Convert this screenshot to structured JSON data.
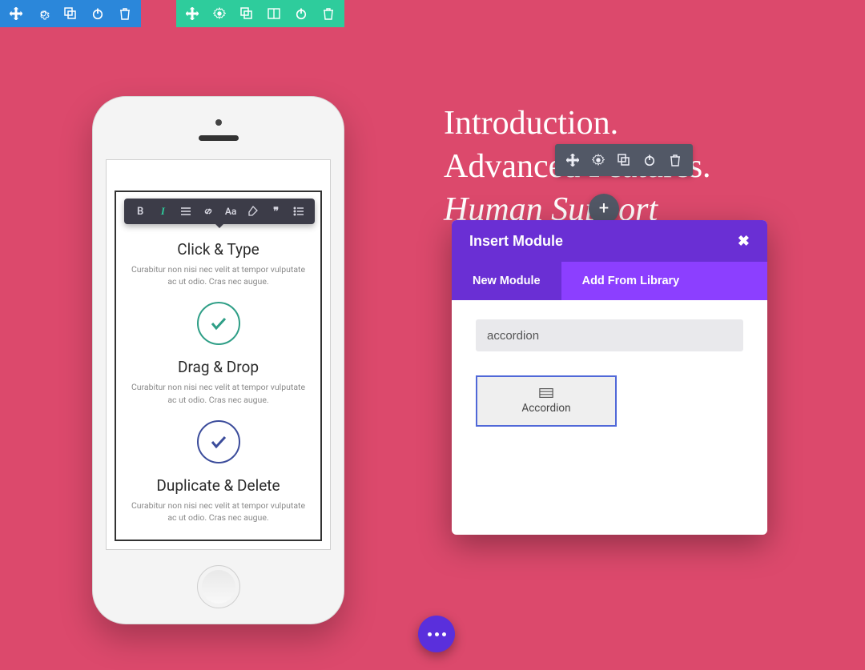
{
  "headline": {
    "line1": "Introduction.",
    "line2": "Advanced Features.",
    "line3": "Human Support"
  },
  "phone": {
    "block1": {
      "title": "Click & Type",
      "desc": "Curabitur non nisi nec velit at tempor vulputate ac ut odio. Cras nec augue."
    },
    "block2": {
      "title": "Drag & Drop",
      "desc": "Curabitur non nisi nec velit at tempor vulputate ac ut odio. Cras nec augue."
    },
    "block3": {
      "title": "Duplicate & Delete",
      "desc": "Curabitur non nisi nec velit at tempor vulputate ac ut odio. Cras nec augue."
    }
  },
  "rte": {
    "bold": "B",
    "italic": "I",
    "aa": "Aa",
    "quote": "❞"
  },
  "modal": {
    "title": "Insert Module",
    "tab_new": "New Module",
    "tab_lib": "Add From Library",
    "search_value": "accordion",
    "item_label": "Accordion"
  },
  "add_btn": "+"
}
